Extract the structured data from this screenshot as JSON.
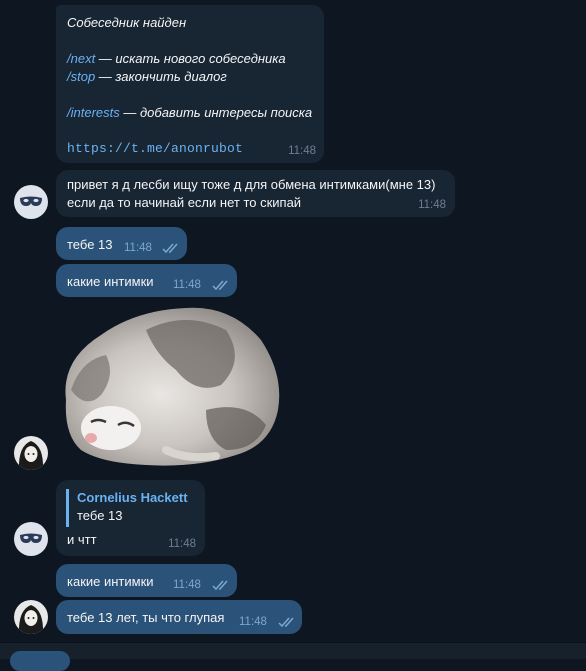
{
  "colors": {
    "background": "#0e1621",
    "incoming": "#182533",
    "outgoing": "#2b5278",
    "link": "#6ab2f2",
    "time": "#6d7f8f"
  },
  "bot_message": {
    "title": "Собеседник найден",
    "cmd1": "/next",
    "cmd1_desc": " — искать нового собеседника",
    "cmd2": "/stop",
    "cmd2_desc": " — закончить диалог",
    "cmd3": "/interests",
    "cmd3_desc": " — добавить интересы поиска",
    "url": "https://t.me/anonrubot",
    "time": "11:48"
  },
  "msg1": {
    "line1": "привет я д лесби ищу тоже д для обмена интимками(мне 13)",
    "line2": "если да то начинай если нет то скипай",
    "time": "11:48"
  },
  "msg2": {
    "text": "тебе 13",
    "time": "11:48"
  },
  "msg3": {
    "text": "какие интимки",
    "time": "11:48"
  },
  "sticker": {
    "icon": "kitten-sticker"
  },
  "msg4": {
    "reply_name": "Cornelius Hackett",
    "reply_text": "тебе 13",
    "text": "и чтт",
    "time": "11:48"
  },
  "msg5": {
    "text": "какие интимки",
    "time": "11:48"
  },
  "msg6": {
    "text": "тебе 13 лет, ты что глупая",
    "time": "11:48"
  }
}
